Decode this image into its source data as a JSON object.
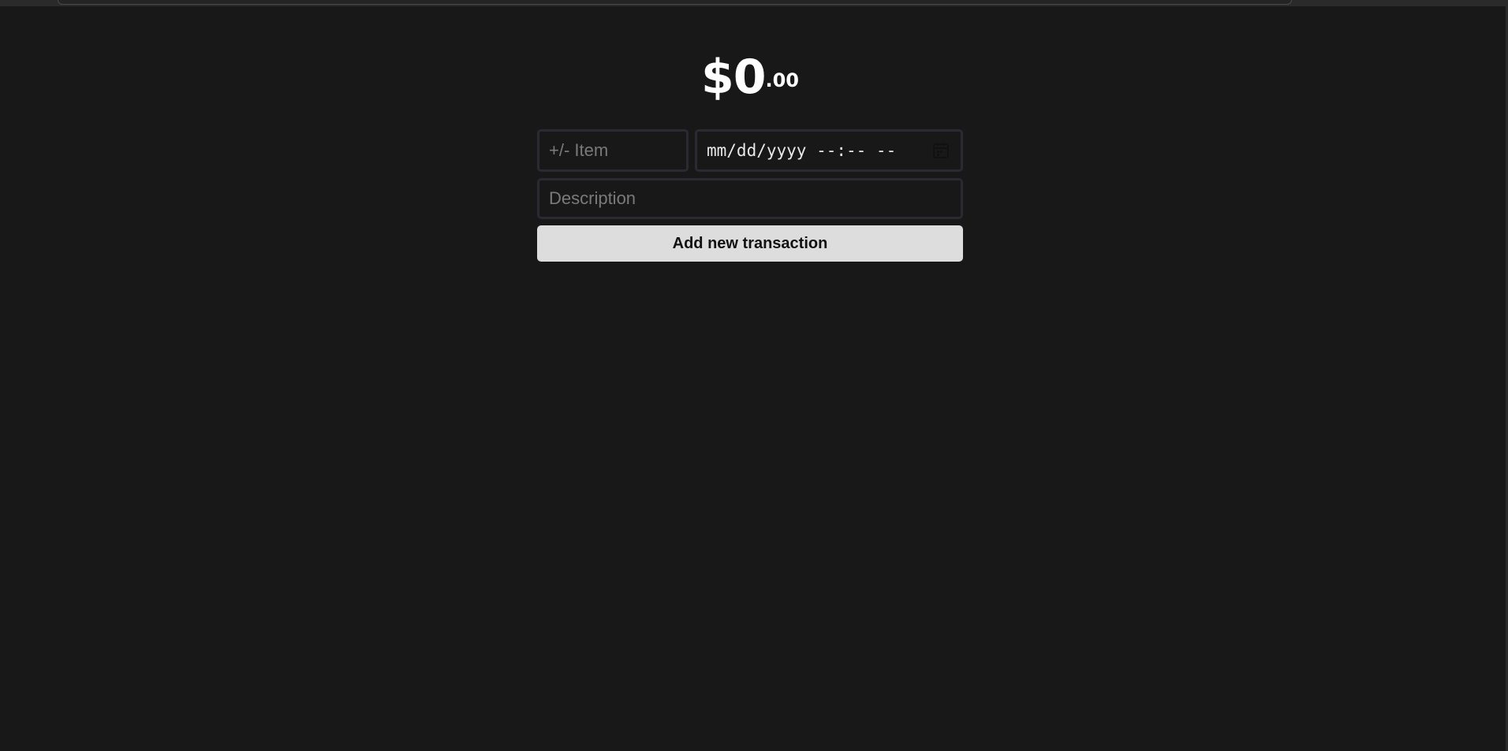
{
  "balance": {
    "dollars": "$0",
    "cents": ".00"
  },
  "form": {
    "item_placeholder": "+/- Item",
    "item_value": "",
    "datetime_placeholder": "mm/dd/yyyy --:-- --",
    "description_placeholder": "Description",
    "description_value": "",
    "submit_label": "Add new transaction"
  },
  "icons": {
    "datetime_picker": "calendar-icon"
  },
  "colors": {
    "background": "#181818",
    "button_background": "#dddddd",
    "input_border": "#2b2a33",
    "text": "#ffffff"
  }
}
